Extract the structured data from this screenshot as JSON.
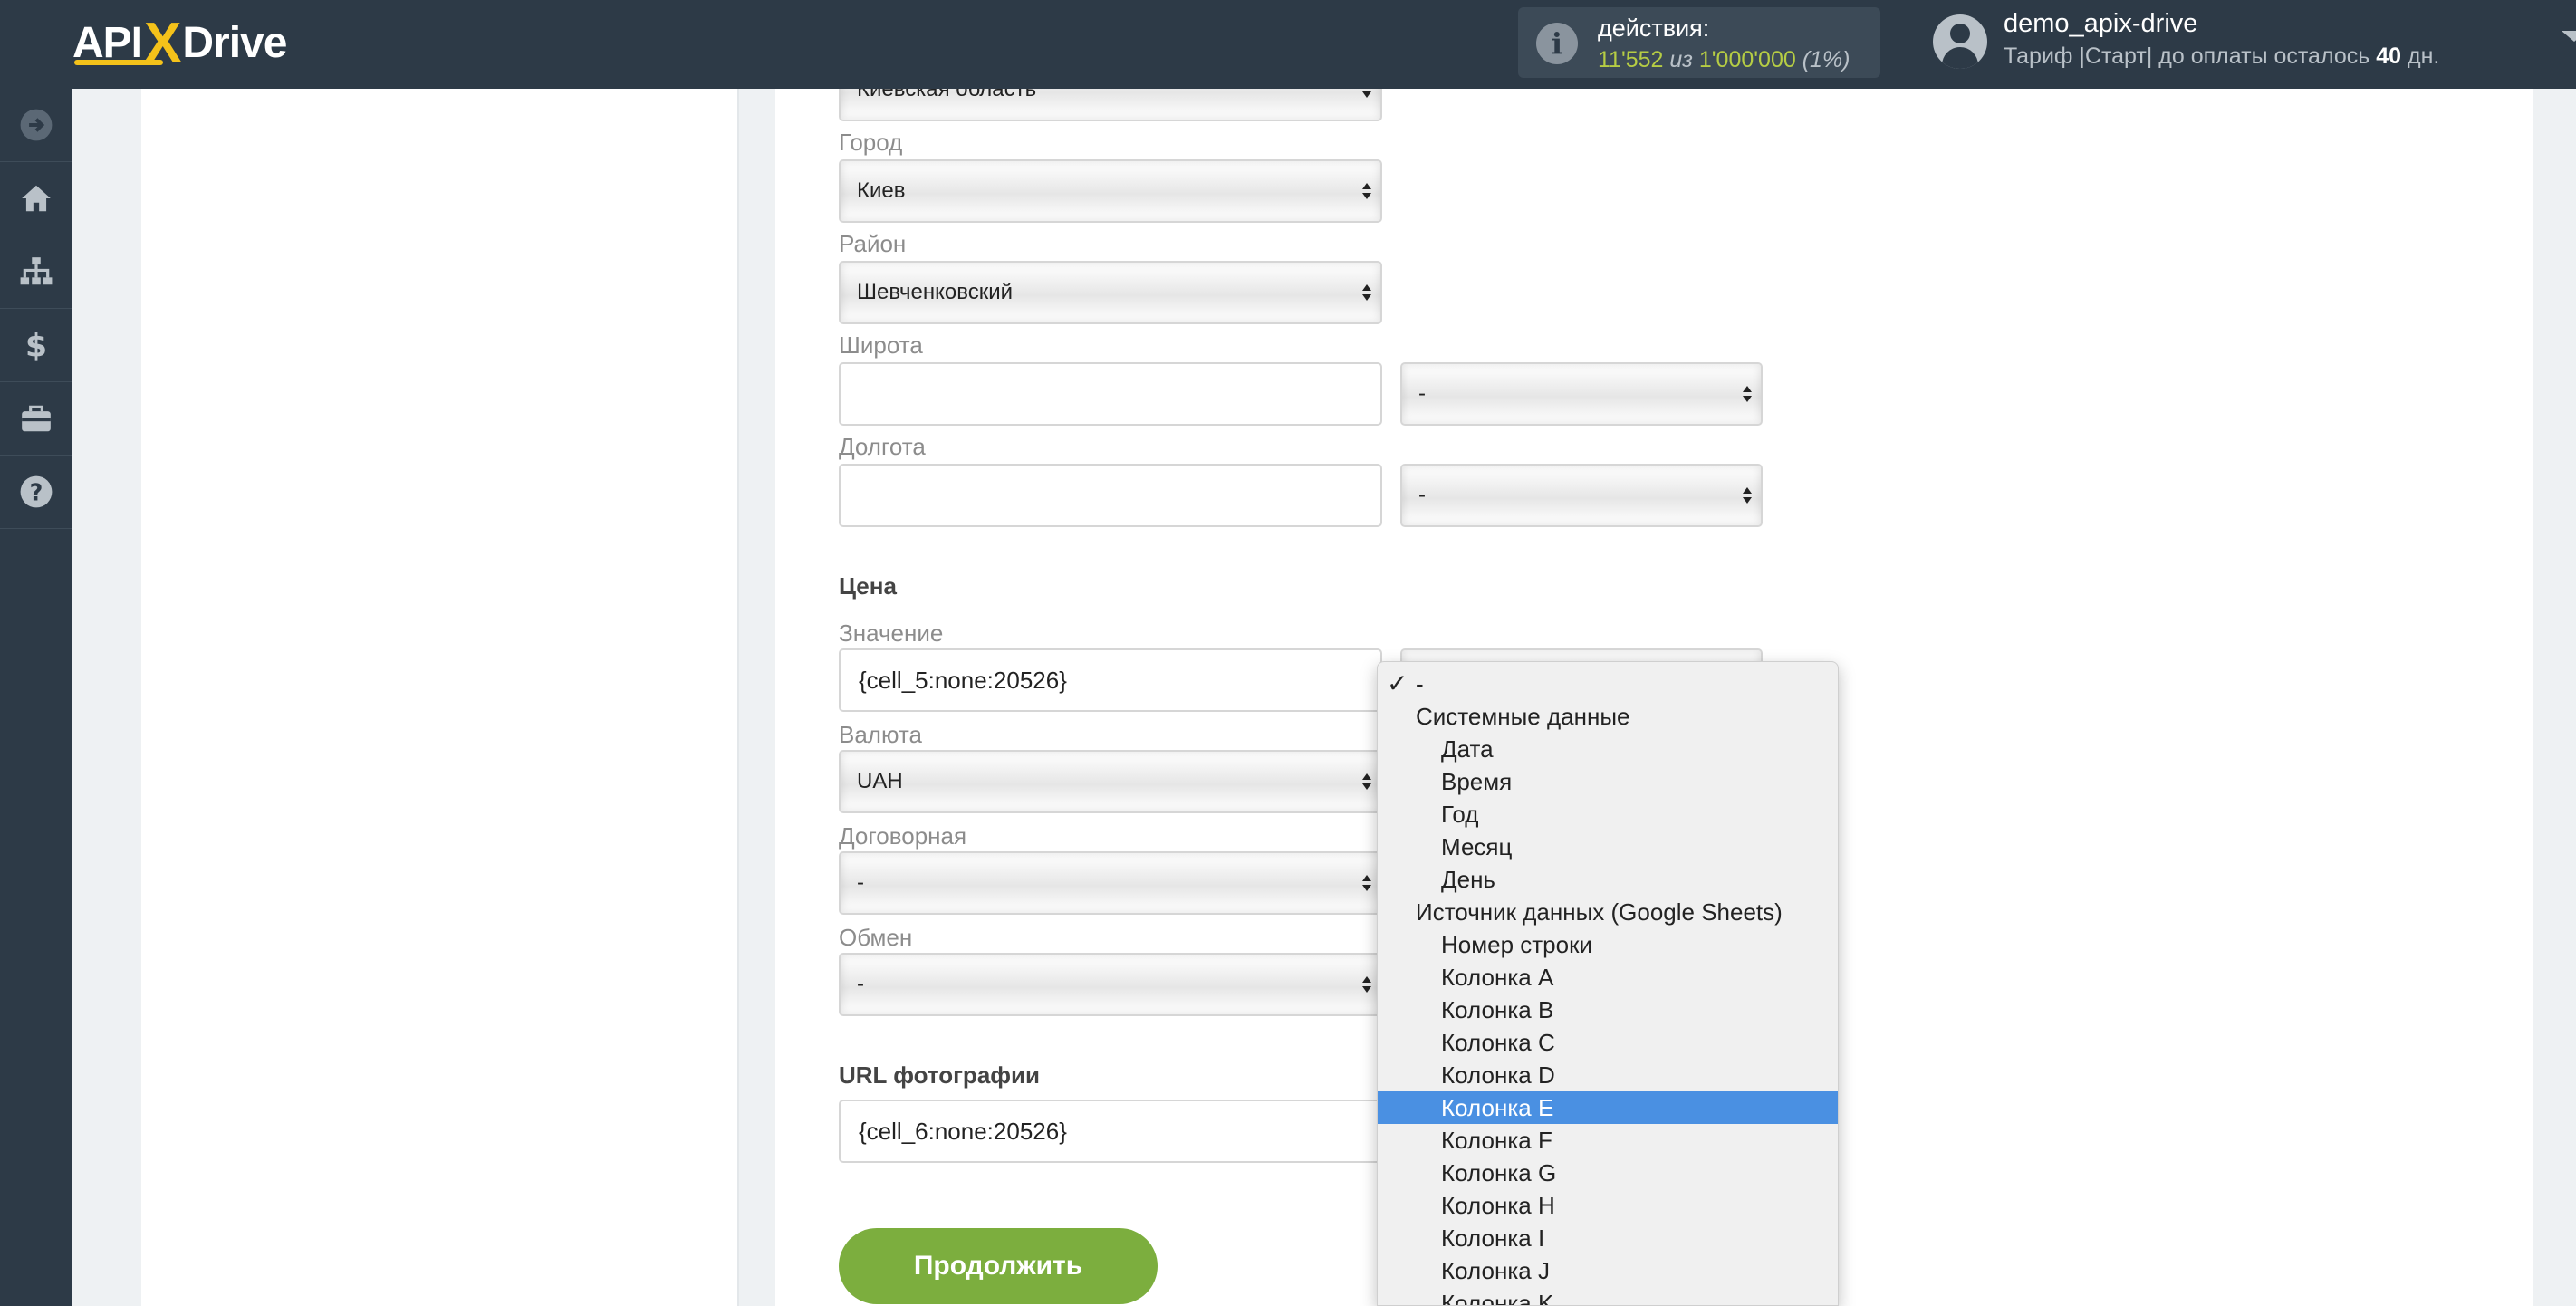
{
  "header": {
    "logo_api": "API",
    "logo_x": "X",
    "logo_drive": "Drive",
    "actions_label": "действия:",
    "actions_used": "11'552",
    "actions_of": "из",
    "actions_total": "1'000'000",
    "actions_pct": "(1%)",
    "user_name": "demo_apix-drive",
    "tariff_text": "Тариф |Старт| до оплаты осталось",
    "days_left": "40",
    "days_suffix": "дн."
  },
  "sidebar": {
    "items": [
      {
        "icon": "arrow-right-circle-icon"
      },
      {
        "icon": "home-icon"
      },
      {
        "icon": "sitemap-icon"
      },
      {
        "icon": "dollar-icon"
      },
      {
        "icon": "briefcase-icon"
      },
      {
        "icon": "help-circle-icon"
      }
    ]
  },
  "form": {
    "region_value": "Киевская область",
    "city_label": "Город",
    "city_value": "Киев",
    "district_label": "Район",
    "district_value": "Шевченковский",
    "latitude_label": "Широта",
    "latitude_value": "",
    "latitude_select": "-",
    "longitude_label": "Долгота",
    "longitude_value": "",
    "longitude_select": "-",
    "price_section": "Цена",
    "value_label": "Значение",
    "value_value": "{cell_5:none:20526}",
    "currency_label": "Валюта",
    "currency_value": "UAH",
    "negotiable_label": "Договорная",
    "negotiable_value": "-",
    "exchange_label": "Обмен",
    "exchange_value": "-",
    "photo_section": "URL фотографии",
    "photo_value": "{cell_6:none:20526}",
    "continue_button": "Продолжить"
  },
  "dropdown": {
    "items": [
      {
        "label": "-",
        "kind": "first",
        "checked": true
      },
      {
        "label": "Системные данные",
        "kind": "group"
      },
      {
        "label": "Дата",
        "kind": "opt"
      },
      {
        "label": "Время",
        "kind": "opt"
      },
      {
        "label": "Год",
        "kind": "opt"
      },
      {
        "label": "Месяц",
        "kind": "opt"
      },
      {
        "label": "День",
        "kind": "opt"
      },
      {
        "label": "Источник данных (Google Sheets)",
        "kind": "group"
      },
      {
        "label": "Номер строки",
        "kind": "opt"
      },
      {
        "label": "Колонка A",
        "kind": "opt"
      },
      {
        "label": "Колонка B",
        "kind": "opt"
      },
      {
        "label": "Колонка C",
        "kind": "opt"
      },
      {
        "label": "Колонка D",
        "kind": "opt"
      },
      {
        "label": "Колонка E",
        "kind": "opt",
        "selected": true
      },
      {
        "label": "Колонка F",
        "kind": "opt"
      },
      {
        "label": "Колонка G",
        "kind": "opt"
      },
      {
        "label": "Колонка H",
        "kind": "opt"
      },
      {
        "label": "Колонка I",
        "kind": "opt"
      },
      {
        "label": "Колонка J",
        "kind": "opt"
      },
      {
        "label": "Колонка K",
        "kind": "opt"
      }
    ]
  },
  "colors": {
    "topbar": "#2d3a47",
    "accent_yellow": "#f4c21a",
    "continue_green": "#7cae3e",
    "selected_blue": "#4a90e2"
  }
}
